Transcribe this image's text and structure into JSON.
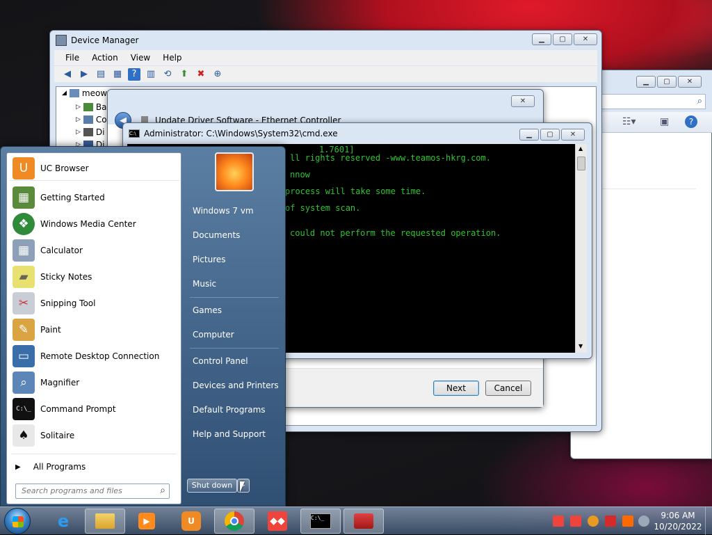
{
  "device_manager": {
    "title": "Device Manager",
    "menus": [
      "File",
      "Action",
      "View",
      "Help"
    ],
    "tree_root": "meow",
    "tree_items": [
      "Ba",
      "Co",
      "Di",
      "Di"
    ]
  },
  "update_driver": {
    "title": "Update Driver Software - Ethernet Controller",
    "next_label": "Next",
    "cancel_label": "Cancel"
  },
  "cmd": {
    "title": "Administrator: C:\\Windows\\System32\\cmd.exe",
    "lines": [
      "1.7601]",
      "ll rights reserved -www.teamos-hkrg.com.",
      "nnow",
      " process will take some time.",
      " of system scan.",
      "could not perform the requested operation."
    ]
  },
  "start_menu": {
    "programs": [
      {
        "label": "UC Browser",
        "icon": "uc-browser-icon",
        "color": "#f08a24"
      },
      {
        "label": "Getting Started",
        "icon": "getting-started-icon",
        "color": "#5a8a3c"
      },
      {
        "label": "Windows Media Center",
        "icon": "media-center-icon",
        "color": "#2f8a3a"
      },
      {
        "label": "Calculator",
        "icon": "calculator-icon",
        "color": "#8da0b8"
      },
      {
        "label": "Sticky Notes",
        "icon": "sticky-notes-icon",
        "color": "#e8e070"
      },
      {
        "label": "Snipping Tool",
        "icon": "snipping-tool-icon",
        "color": "#c9ced6"
      },
      {
        "label": "Paint",
        "icon": "paint-icon",
        "color": "#d9a441"
      },
      {
        "label": "Remote Desktop Connection",
        "icon": "remote-desktop-icon",
        "color": "#3a6ea8"
      },
      {
        "label": "Magnifier",
        "icon": "magnifier-icon",
        "color": "#5d86b8"
      },
      {
        "label": "Command Prompt",
        "icon": "command-prompt-icon",
        "color": "#111111"
      },
      {
        "label": "Solitaire",
        "icon": "solitaire-icon",
        "color": "#e8e8e8"
      }
    ],
    "all_programs": "All Programs",
    "search_placeholder": "Search programs and files",
    "right_items": [
      "Windows 7 vm",
      "Documents",
      "Pictures",
      "Music",
      "Games",
      "Computer",
      "Control Panel",
      "Devices and Printers",
      "Default Programs",
      "Help and Support"
    ],
    "shutdown_label": "Shut down"
  },
  "taskbar": {
    "apps": [
      "internet-explorer-icon",
      "file-explorer-icon",
      "media-player-icon",
      "uc-browser-icon",
      "chrome-icon",
      "anydesk-icon",
      "command-prompt-icon",
      "toolbox-icon"
    ],
    "time": "9:06 AM",
    "date": "10/20/2022"
  }
}
